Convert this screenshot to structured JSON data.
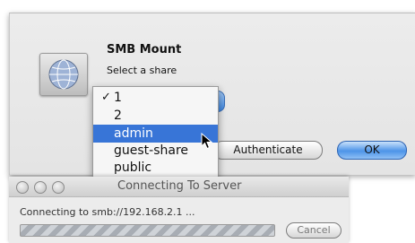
{
  "smb_dialog": {
    "title": "SMB Mount",
    "subtitle": "Select a share",
    "authenticate_label": "Authenticate",
    "ok_label": "OK"
  },
  "share_menu": {
    "items": [
      {
        "label": "1",
        "checked": "✓"
      },
      {
        "label": "2"
      },
      {
        "label": "admin"
      },
      {
        "label": "guest-share"
      },
      {
        "label": "public"
      }
    ],
    "highlighted": "admin"
  },
  "connect_window": {
    "title": "Connecting To Server",
    "status": "Connecting to smb://192.168.2.1 ...",
    "cancel_label": "Cancel"
  },
  "icons": {
    "app": "network-globe-icon",
    "pointer": "mouse-pointer-icon"
  },
  "colors": {
    "highlight": "#3875d7",
    "ok_button": "#4d94e8"
  }
}
